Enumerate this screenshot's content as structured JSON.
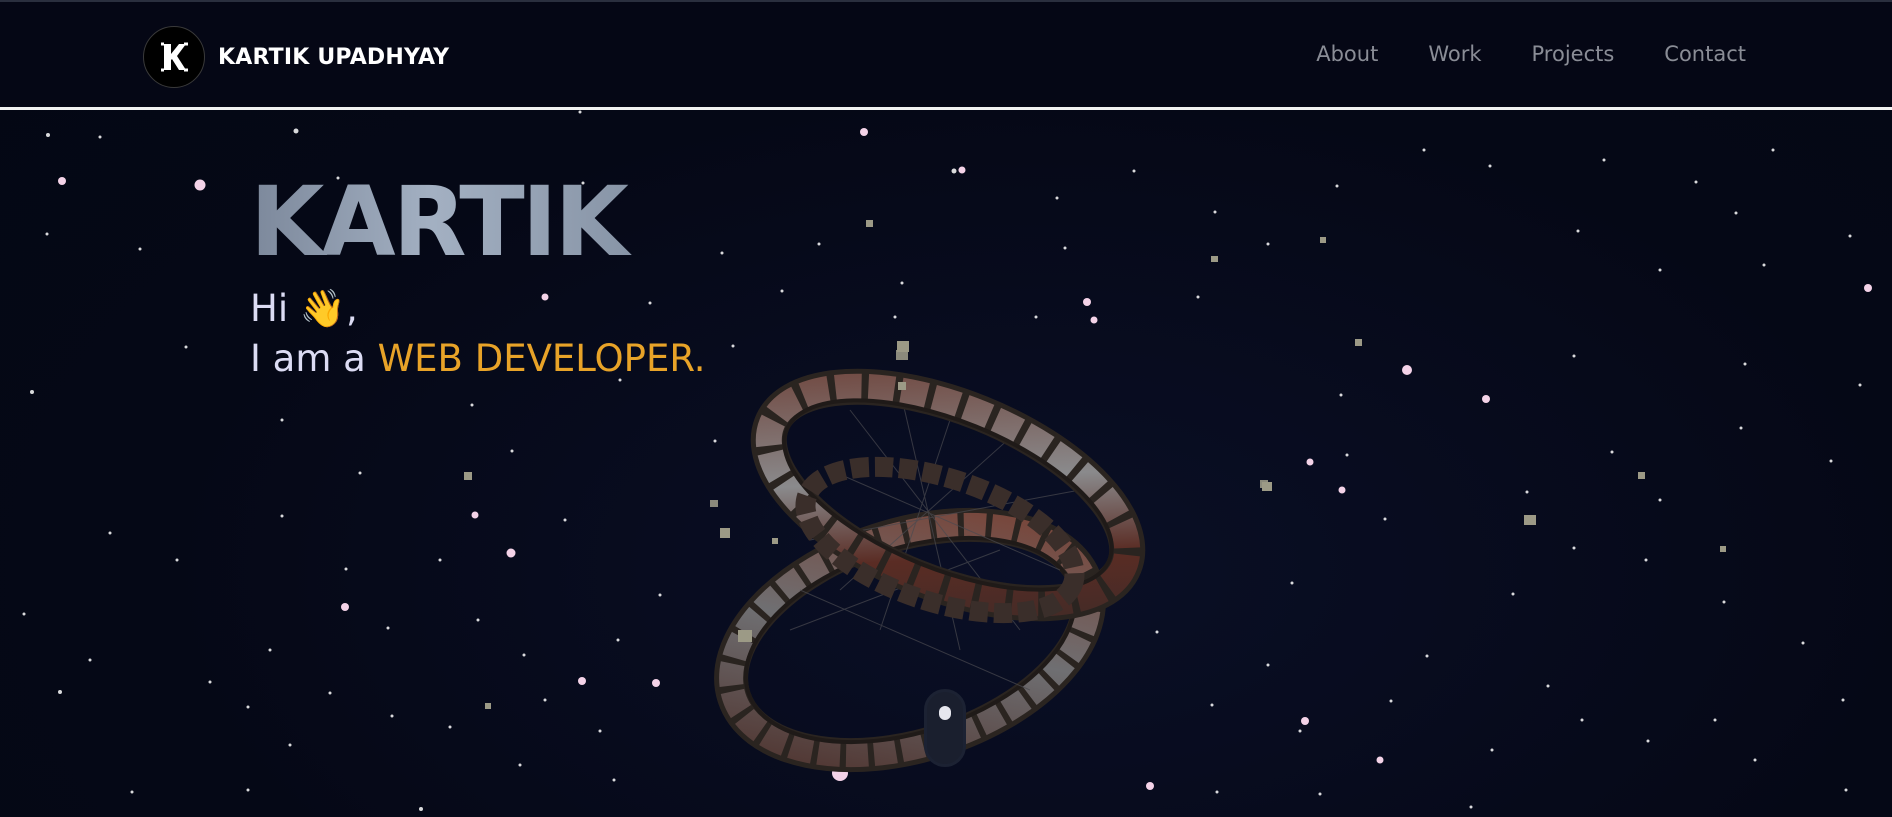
{
  "brand": {
    "logo_letter": "K",
    "name": "KARTIK UPADHYAY"
  },
  "nav": {
    "links": [
      {
        "label": "About"
      },
      {
        "label": "Work"
      },
      {
        "label": "Projects"
      },
      {
        "label": "Contact"
      }
    ]
  },
  "hero": {
    "name": "KARTIK",
    "greeting_prefix": "Hi ",
    "greeting_emoji": "👋",
    "greeting_suffix": ",",
    "role_prefix": "I am a ",
    "role_highlight": "WEB DEVELOPER."
  },
  "colors": {
    "background": "#050816",
    "accent": "#e8a328",
    "nav_link": "#8a8d96",
    "hero_text": "#dcdcf4"
  },
  "icons": {
    "scroll": "mouse-scroll-icon",
    "logo": "k-logo-icon"
  }
}
